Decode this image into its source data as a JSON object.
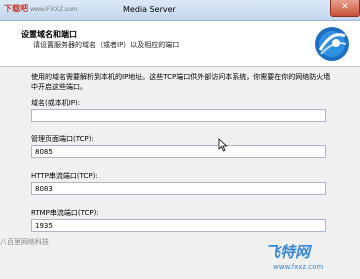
{
  "window": {
    "watermark_top": "下载吧",
    "watermark_url": "www.FXXZ.com",
    "title": "Media Server",
    "close_symbol": "✕"
  },
  "header": {
    "title": "设置域名和端口",
    "subtitle": "请设置服务器的域名（或者IP）以及相应的端口"
  },
  "content": {
    "description": "使用的域名需要解析到本机的IP地址。这些TCP端口供外部访问本系统，你需要在你的网络防火墙中开启这些端口。",
    "fields": [
      {
        "label": "域名(或本机IP):",
        "value": ""
      },
      {
        "label": "管理页面端口(TCP):",
        "value": "8085"
      },
      {
        "label": "HTTP串流端口(TCP):",
        "value": "8083"
      },
      {
        "label": "RTMP串流端口(TCP):",
        "value": "1935"
      }
    ]
  },
  "footer": {
    "brand_text": "八百里网络科技"
  },
  "overlay": {
    "brand": "飞特网",
    "url": "www.fxxz.com"
  },
  "colors": {
    "accent": "#3a88d6",
    "focus_border": "#569de5"
  },
  "icons": {
    "logo": "media-server-logo-icon",
    "cursor": "mouse-cursor-icon"
  }
}
